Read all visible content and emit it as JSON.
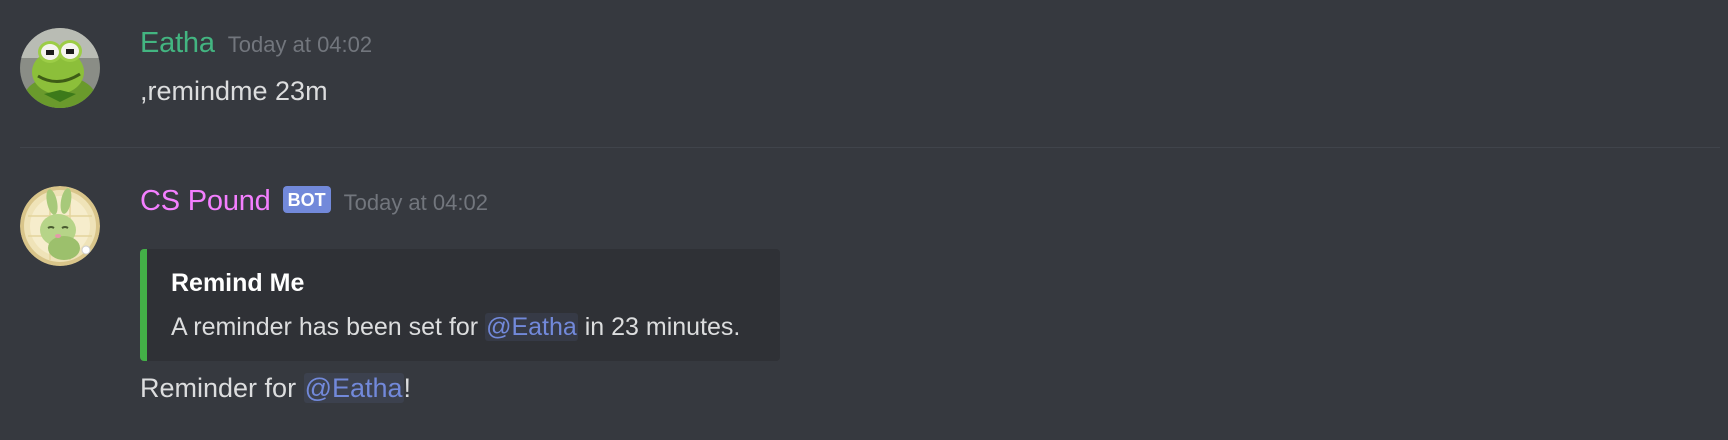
{
  "messages": [
    {
      "author": "Eatha",
      "author_color": "#43b581",
      "timestamp": "Today at 04:02",
      "avatar_icon": "kermit-frog-avatar",
      "text": ",remindme 23m"
    },
    {
      "author": "CS Pound",
      "author_color": "#f47fff",
      "bot_tag": "BOT",
      "timestamp": "Today at 04:02",
      "avatar_icon": "green-rabbit-avatar",
      "embed": {
        "accent_color": "#43b047",
        "title": "Remind Me",
        "description_prefix": "A reminder has been set for ",
        "description_mention": "@Eatha",
        "description_suffix": " in 23 minutes."
      },
      "text_prefix": "Reminder for ",
      "text_mention": "@Eatha",
      "text_suffix": "!"
    }
  ],
  "colors": {
    "background": "#36393f",
    "embed_background": "#2f3136",
    "mention": "#7289da",
    "timestamp": "#72767d"
  }
}
